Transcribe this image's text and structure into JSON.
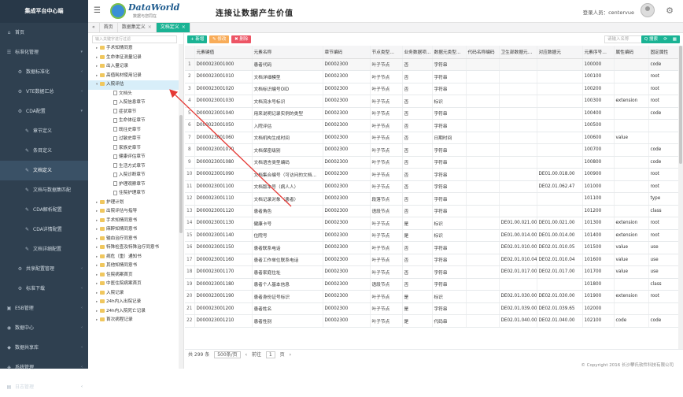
{
  "app": {
    "brand": "集成平台中心端"
  },
  "header": {
    "logo_name": "DataWorld",
    "logo_sub": "数据与您同在",
    "slogan": "连接让数据产生价值",
    "login_label": "登录人员：",
    "login_user": "centervue"
  },
  "sidebar": {
    "items": [
      {
        "label": "首页",
        "icon": "home-icon",
        "glyph": "⌂",
        "level": 0,
        "arrow": ""
      },
      {
        "label": "标准化管理",
        "icon": "list-icon",
        "glyph": "☰",
        "level": 0,
        "arrow": "▾"
      },
      {
        "label": "数据标准化",
        "icon": "gear-icon",
        "glyph": "⚙",
        "level": 1,
        "arrow": "‹"
      },
      {
        "label": "VTE数据汇总",
        "icon": "gear-icon",
        "glyph": "⚙",
        "level": 1,
        "arrow": "‹"
      },
      {
        "label": "CDA配置",
        "icon": "gear-icon",
        "glyph": "⚙",
        "level": 1,
        "arrow": "▾"
      },
      {
        "label": "章节定义",
        "icon": "chart-icon",
        "glyph": "✎",
        "level": 2,
        "arrow": ""
      },
      {
        "label": "条目定义",
        "icon": "chart-icon",
        "glyph": "✎",
        "level": 2,
        "arrow": ""
      },
      {
        "label": "文档定义",
        "icon": "chart-icon",
        "glyph": "✎",
        "level": 2,
        "arrow": "",
        "active": true
      },
      {
        "label": "文档与数据集匹配",
        "icon": "chart-icon",
        "glyph": "✎",
        "level": 2,
        "arrow": ""
      },
      {
        "label": "CDA解析配置",
        "icon": "chart-icon",
        "glyph": "✎",
        "level": 2,
        "arrow": ""
      },
      {
        "label": "CDA详情配置",
        "icon": "chart-icon",
        "glyph": "✎",
        "level": 2,
        "arrow": ""
      },
      {
        "label": "文档详细配置",
        "icon": "chart-icon",
        "glyph": "✎",
        "level": 2,
        "arrow": ""
      },
      {
        "label": "共享配置管理",
        "icon": "gear-icon",
        "glyph": "⚙",
        "level": 1,
        "arrow": "‹"
      },
      {
        "label": "标准下载",
        "icon": "gear-icon",
        "glyph": "⚙",
        "level": 1,
        "arrow": "‹"
      },
      {
        "label": "ESB管理",
        "icon": "esb-icon",
        "glyph": "▣",
        "level": 0,
        "arrow": "‹"
      },
      {
        "label": "数据中心",
        "icon": "database-icon",
        "glyph": "◉",
        "level": 0,
        "arrow": "‹"
      },
      {
        "label": "数据共享库",
        "icon": "share-icon",
        "glyph": "◆",
        "level": 0,
        "arrow": "‹"
      },
      {
        "label": "系统管理",
        "icon": "system-icon",
        "glyph": "◈",
        "level": 0,
        "arrow": "‹"
      },
      {
        "label": "日志管理",
        "icon": "log-icon",
        "glyph": "▤",
        "level": 0,
        "arrow": "‹"
      }
    ]
  },
  "tabs": [
    {
      "label": "首页",
      "active": false
    },
    {
      "label": "数据集定义",
      "active": false
    },
    {
      "label": "文档定义",
      "active": true
    }
  ],
  "tree": {
    "search_placeholder": "输入关键字进行过滤",
    "items": [
      {
        "label": "手术知情同意",
        "type": "folder",
        "level": 0,
        "toggle": "▸"
      },
      {
        "label": "生命体征测量记录",
        "type": "folder",
        "level": 0,
        "toggle": "▸"
      },
      {
        "label": "出入量记录",
        "type": "folder",
        "level": 0,
        "toggle": "▸"
      },
      {
        "label": "高值耗材使用记录",
        "type": "folder",
        "level": 0,
        "toggle": "▸"
      },
      {
        "label": "入院评估",
        "type": "folder",
        "level": 0,
        "toggle": "▾",
        "selected": true
      },
      {
        "label": "文档头",
        "type": "file",
        "level": 1,
        "toggle": ""
      },
      {
        "label": "入院信息章节",
        "type": "file",
        "level": 1,
        "toggle": ""
      },
      {
        "label": "症状章节",
        "type": "file",
        "level": 1,
        "toggle": ""
      },
      {
        "label": "生命体征章节",
        "type": "file",
        "level": 1,
        "toggle": ""
      },
      {
        "label": "既往史章节",
        "type": "file",
        "level": 1,
        "toggle": ""
      },
      {
        "label": "过敏史章节",
        "type": "file",
        "level": 1,
        "toggle": ""
      },
      {
        "label": "家族史章节",
        "type": "file",
        "level": 1,
        "toggle": ""
      },
      {
        "label": "健康评估章节",
        "type": "file",
        "level": 1,
        "toggle": ""
      },
      {
        "label": "生活方式章节",
        "type": "file",
        "level": 1,
        "toggle": ""
      },
      {
        "label": "入院诊断章节",
        "type": "file",
        "level": 1,
        "toggle": ""
      },
      {
        "label": "护理观察章节",
        "type": "file",
        "level": 1,
        "toggle": ""
      },
      {
        "label": "住院护理章节",
        "type": "file",
        "level": 1,
        "toggle": ""
      },
      {
        "label": "护理计划",
        "type": "folder",
        "level": 0,
        "toggle": "▸"
      },
      {
        "label": "出院评估与指导",
        "type": "folder",
        "level": 0,
        "toggle": "▸"
      },
      {
        "label": "手术知情同意书",
        "type": "folder",
        "level": 0,
        "toggle": "▸"
      },
      {
        "label": "麻醉知情同意书",
        "type": "folder",
        "level": 0,
        "toggle": "▸"
      },
      {
        "label": "输血治疗同意书",
        "type": "folder",
        "level": 0,
        "toggle": "▸"
      },
      {
        "label": "特殊检查及特殊治疗同意书",
        "type": "folder",
        "level": 0,
        "toggle": "▸"
      },
      {
        "label": "病危（重）通知书",
        "type": "folder",
        "level": 0,
        "toggle": "▸"
      },
      {
        "label": "其他知情同意书",
        "type": "folder",
        "level": 0,
        "toggle": "▸"
      },
      {
        "label": "住院病案首页",
        "type": "folder",
        "level": 0,
        "toggle": "▸"
      },
      {
        "label": "中医住院病案首页",
        "type": "folder",
        "level": 0,
        "toggle": "▸"
      },
      {
        "label": "入院记录",
        "type": "folder",
        "level": 0,
        "toggle": "▸"
      },
      {
        "label": "24h内入出院记录",
        "type": "folder",
        "level": 0,
        "toggle": "▸"
      },
      {
        "label": "24h内入院死亡记录",
        "type": "folder",
        "level": 0,
        "toggle": "▸"
      },
      {
        "label": "首次病程记录",
        "type": "folder",
        "level": 0,
        "toggle": "▸"
      }
    ]
  },
  "toolbar": {
    "add_label": "+ 新增",
    "edit_label": "✎ 修改",
    "delete_label": "✖ 删除",
    "search_placeholder": "请输入名称",
    "search_label": "Q 搜索",
    "refresh_label": "⟳",
    "columns_label": "▦"
  },
  "grid": {
    "columns": [
      "",
      "元素键值",
      "元素名称",
      "章节编码",
      "节点类型…",
      "业务数据项…",
      "数据元类型…",
      "代码名称编码",
      "卫生部数据元…",
      "对应数据元",
      "元素序号…",
      "属性编码",
      "固定属性"
    ],
    "rows": [
      [
        "1",
        "D000023001000",
        "患者代码",
        "D0002300",
        "叶子节点",
        "否",
        "字符串",
        "",
        "",
        "",
        "100000",
        "",
        "code"
      ],
      [
        "2",
        "D000023001010",
        "文档详细模型",
        "D0002300",
        "叶子节点",
        "否",
        "字符串",
        "",
        "",
        "",
        "100100",
        "",
        "root"
      ],
      [
        "3",
        "D000023001020",
        "文档标识编号OID",
        "D0002300",
        "叶子节点",
        "否",
        "字符串",
        "",
        "",
        "",
        "100200",
        "",
        "root"
      ],
      [
        "4",
        "D000023001030",
        "文档流水号标识",
        "D0002300",
        "叶子节点",
        "否",
        "标识",
        "",
        "",
        "",
        "100300",
        "extension",
        "root"
      ],
      [
        "5",
        "D000023001040",
        "用来说明记录实例的类型",
        "D0002300",
        "叶子节点",
        "否",
        "字符串",
        "",
        "",
        "",
        "100400",
        "",
        "code"
      ],
      [
        "6",
        "D000023001050",
        "入院评估",
        "D0002300",
        "叶子节点",
        "否",
        "字符串",
        "",
        "",
        "",
        "100500",
        "",
        ""
      ],
      [
        "7",
        "D000023001060",
        "文档机构生成时间",
        "D0002300",
        "叶子节点",
        "否",
        "日期时间",
        "",
        "",
        "",
        "100600",
        "value",
        ""
      ],
      [
        "8",
        "D000023001070",
        "文档保密级别",
        "D0002300",
        "叶子节点",
        "否",
        "字符串",
        "",
        "",
        "",
        "100700",
        "",
        "code"
      ],
      [
        "9",
        "D000023001080",
        "文档语言类型编码",
        "D0002300",
        "叶子节点",
        "否",
        "字符串",
        "",
        "",
        "",
        "100800",
        "",
        "code"
      ],
      [
        "10",
        "D000023001090",
        "文档集合编号（可访问的文档…",
        "D0002300",
        "叶子节点",
        "否",
        "字符串",
        "",
        "",
        "DE01.00.018.00",
        "100900",
        "",
        "root"
      ],
      [
        "11",
        "D000023001100",
        "文档版本号（病人人）",
        "D0002300",
        "叶子节点",
        "否",
        "字符串",
        "",
        "",
        "DE02.01.062.47",
        "101000",
        "",
        "root"
      ],
      [
        "12",
        "D000023001110",
        "文档记录对象（患者）",
        "D0002300",
        "段落节点",
        "否",
        "字符串",
        "",
        "",
        "",
        "101100",
        "",
        "type"
      ],
      [
        "13",
        "D000023001120",
        "患者角色",
        "D0002300",
        "语段节点",
        "否",
        "字符串",
        "",
        "",
        "",
        "101200",
        "",
        "class"
      ],
      [
        "14",
        "D000023001130",
        "健康卡号",
        "D0002300",
        "叶子节点",
        "是",
        "标识",
        "",
        "DE01.00.021.00",
        "DE01.00.021.00",
        "101300",
        "extension",
        "root"
      ],
      [
        "15",
        "D000023001140",
        "住院号",
        "D0002300",
        "叶子节点",
        "是",
        "标识",
        "",
        "DE01.00.014.00",
        "DE01.00.014.00",
        "101400",
        "extension",
        "root"
      ],
      [
        "16",
        "D000023001150",
        "患者联系电话",
        "D0002300",
        "叶子节点",
        "否",
        "字符串",
        "",
        "DE02.01.010.00",
        "DE02.01.010.05",
        "101500",
        "value",
        "use"
      ],
      [
        "17",
        "D000023001160",
        "患者工作单位联系电话",
        "D0002300",
        "叶子节点",
        "否",
        "字符串",
        "",
        "DE02.01.010.04",
        "DE02.01.010.04",
        "101600",
        "value",
        "use"
      ],
      [
        "18",
        "D000023001170",
        "患者家庭住址",
        "D0002300",
        "叶子节点",
        "否",
        "字符串",
        "",
        "DE02.01.017.00",
        "DE02.01.017.00",
        "101700",
        "value",
        "use"
      ],
      [
        "19",
        "D000023001180",
        "患者个人基本信息",
        "D0002300",
        "语段节点",
        "否",
        "字符串",
        "",
        "",
        "",
        "101800",
        "",
        "class"
      ],
      [
        "20",
        "D000023001190",
        "患者身份证号标识",
        "D0002300",
        "叶子节点",
        "是",
        "标识",
        "",
        "DE02.01.030.00",
        "DE02.01.030.00",
        "101900",
        "extension",
        "root"
      ],
      [
        "21",
        "D000023001200",
        "患者姓名",
        "D0002300",
        "叶子节点",
        "是",
        "字符串",
        "",
        "DE02.01.039.00",
        "DE02.01.039.65",
        "102000",
        "",
        ""
      ],
      [
        "22",
        "D000023001210",
        "患者性别",
        "D0002300",
        "叶子节点",
        "是",
        "代码串",
        "",
        "DE02.01.040.00",
        "DE02.01.040.00",
        "102100",
        "code",
        "code"
      ]
    ]
  },
  "pager": {
    "total": "共 299 条",
    "page_size": "500条/页",
    "prev": "‹",
    "first": "前往",
    "page": "1",
    "unit": "页",
    "next": "›"
  },
  "footer": {
    "copyright": "© Copyright 2016 长沙攀氏软件科技有限公司"
  },
  "colors": {
    "accent": "#1ab394",
    "sidebar": "#2f4050",
    "annotation_arrow": "#e53935"
  }
}
